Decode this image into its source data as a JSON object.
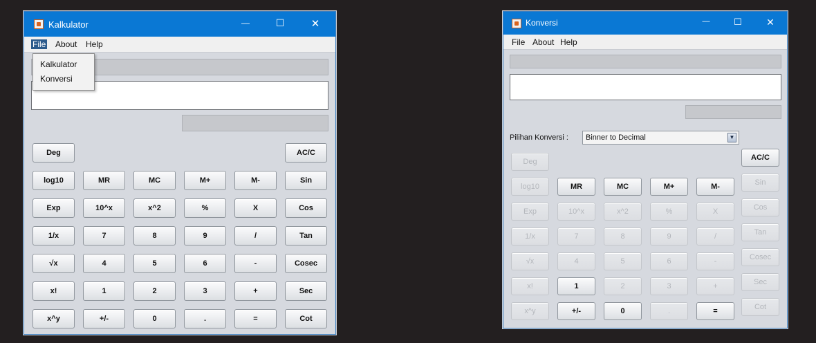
{
  "calc": {
    "title": "Kalkulator",
    "menu": [
      "File",
      "About",
      "Help"
    ],
    "dropdown": [
      "Kalkulator",
      "Konversi"
    ],
    "buttons": {
      "deg": "Deg",
      "acc": "AC/C",
      "log10": "log10",
      "mr": "MR",
      "mc": "MC",
      "mplus": "M+",
      "mminus": "M-",
      "sin": "Sin",
      "exp": "Exp",
      "tenx": "10^x",
      "xsq": "x^2",
      "pct": "%",
      "mul": "X",
      "cos": "Cos",
      "inv": "1/x",
      "n7": "7",
      "n8": "8",
      "n9": "9",
      "div": "/",
      "tan": "Tan",
      "sqrt": "√x",
      "n4": "4",
      "n5": "5",
      "n6": "6",
      "sub": "-",
      "cosec": "Cosec",
      "fact": "x!",
      "n1": "1",
      "n2": "2",
      "n3": "3",
      "add": "+",
      "sec": "Sec",
      "xpowy": "x^y",
      "neg": "+/-",
      "n0": "0",
      "dot": ".",
      "eq": "=",
      "cot": "Cot"
    }
  },
  "conv": {
    "title": "Konversi",
    "menu": [
      "File",
      "About",
      "Help"
    ],
    "option_label": "Pilihan Konversi :",
    "option_value": "Binner to Decimal",
    "buttons": {
      "deg": "Deg",
      "acc": "AC/C",
      "log10": "log10",
      "mr": "MR",
      "mc": "MC",
      "mplus": "M+",
      "mminus": "M-",
      "sin": "Sin",
      "exp": "Exp",
      "tenx": "10^x",
      "xsq": "x^2",
      "pct": "%",
      "mul": "X",
      "cos": "Cos",
      "inv": "1/x",
      "n7": "7",
      "n8": "8",
      "n9": "9",
      "div": "/",
      "tan": "Tan",
      "sqrt": "√x",
      "n4": "4",
      "n5": "5",
      "n6": "6",
      "sub": "-",
      "cosec": "Cosec",
      "fact": "x!",
      "n1": "1",
      "n2": "2",
      "n3": "3",
      "add": "+",
      "sec": "Sec",
      "xpowy": "x^y",
      "neg": "+/-",
      "n0": "0",
      "dot": ".",
      "eq": "=",
      "cot": "Cot"
    }
  },
  "window_controls": {
    "minimize": "—",
    "maximize": "☐",
    "close": "✕"
  }
}
